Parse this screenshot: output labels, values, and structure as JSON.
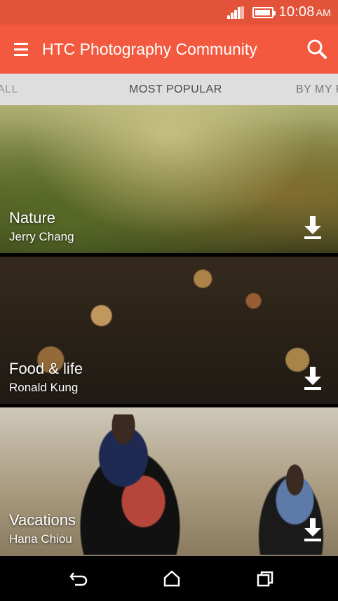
{
  "status_bar": {
    "time": "10:08",
    "ampm": "AM",
    "icons": [
      "signal-icon",
      "battery-icon"
    ]
  },
  "app_bar": {
    "title": "HTC Photography Community",
    "icons": [
      "menu-icon",
      "search-icon"
    ]
  },
  "tabs": [
    {
      "label": "ALL"
    },
    {
      "label": "MOST POPULAR",
      "selected": true
    },
    {
      "label": "BY MY F"
    }
  ],
  "cards": [
    {
      "title": "Nature",
      "author": "Jerry Chang",
      "icon": "download-icon"
    },
    {
      "title": "Food & life",
      "author": "Ronald Kung",
      "icon": "download-icon"
    },
    {
      "title": "Vacations",
      "author": "Hana Chiou",
      "icon": "download-icon"
    }
  ],
  "nav_bar": {
    "icons": [
      "back-icon",
      "home-icon",
      "recent-apps-icon"
    ]
  },
  "colors": {
    "status_bar": "#e2533a",
    "app_bar": "#f2593e",
    "tabs_bg": "#dedede",
    "nav_bar": "#000000"
  }
}
